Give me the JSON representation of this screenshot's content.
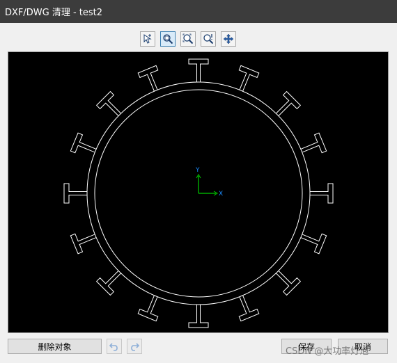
{
  "window": {
    "title": "DXF/DWG 清理 - test2",
    "background": "#f0f0f0",
    "titlebar_color": "#3c3c3c"
  },
  "toolbar": {
    "tools": [
      {
        "name": "select-tool",
        "icon": "select-icon",
        "active": false
      },
      {
        "name": "zoom-window-tool",
        "icon": "zoom-window-icon",
        "active": true
      },
      {
        "name": "zoom-extents-tool",
        "icon": "zoom-extents-icon",
        "active": false
      },
      {
        "name": "zoom-realtime-tool",
        "icon": "zoom-realtime-icon",
        "active": false
      },
      {
        "name": "pan-tool",
        "icon": "pan-icon",
        "active": false
      }
    ]
  },
  "canvas": {
    "background": "#000000",
    "stroke": "#ffffff",
    "axis_x_color": "#1a8cff",
    "axis_y_color": "#00cc00",
    "axis_x_label": "X",
    "axis_y_label": "Y",
    "stud_count": 16
  },
  "bottom": {
    "delete_label": "删除对象",
    "undo_icon": "undo-icon",
    "redo_icon": "redo-icon",
    "save_label": "保存",
    "cancel_label": "取消"
  },
  "watermark": "CSDN @大功率灯泡"
}
